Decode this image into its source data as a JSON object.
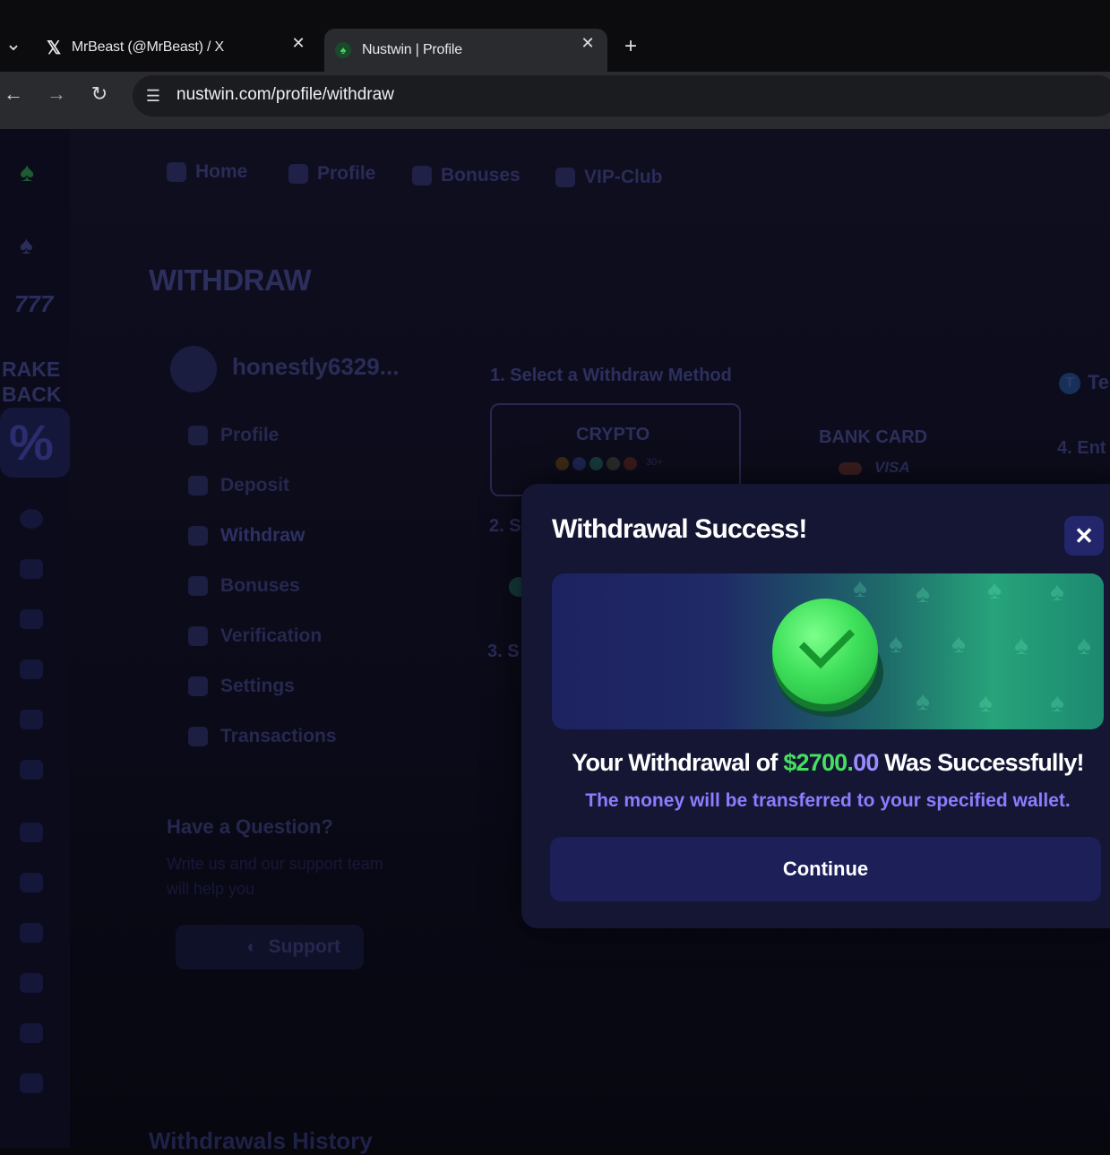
{
  "browser": {
    "tabs": [
      {
        "title": "MrBeast (@MrBeast) / X",
        "icon": "x-logo-icon"
      },
      {
        "title": "Nustwin | Profile",
        "icon": "nustwin-logo-icon"
      }
    ],
    "new_tab": "+",
    "url": "nustwin.com/profile/withdraw"
  },
  "nav": {
    "items": [
      {
        "label": "Home",
        "icon": "home-icon"
      },
      {
        "label": "Profile",
        "icon": "user-icon"
      },
      {
        "label": "Bonuses",
        "icon": "gift-icon"
      },
      {
        "label": "VIP-Club",
        "icon": "star-icon"
      }
    ]
  },
  "sidebar": {
    "rakeback_line1": "RAKE",
    "rakeback_line2": "BACK",
    "sevens": "777"
  },
  "page": {
    "title": "WITHDRAW",
    "username": "honestly6329...",
    "menu": [
      {
        "label": "Profile",
        "icon": "user-icon"
      },
      {
        "label": "Deposit",
        "icon": "wallet-icon"
      },
      {
        "label": "Withdraw",
        "icon": "bag-icon"
      },
      {
        "label": "Bonuses",
        "icon": "gift-icon"
      },
      {
        "label": "Verification",
        "icon": "shield-icon"
      },
      {
        "label": "Settings",
        "icon": "gear-icon"
      },
      {
        "label": "Transactions",
        "icon": "list-icon"
      }
    ],
    "method_label": "1. Select a Withdraw Method",
    "crypto_label": "CRYPTO",
    "crypto_more": "30+",
    "bank_label": "BANK CARD",
    "visa_label": "VISA",
    "step2": "2. S",
    "step3": "3. S",
    "right_te": "Te",
    "right_t": "T",
    "right_ent": "4. Ent",
    "question_title": "Have a Question?",
    "question_text": "Write us and our support team will help you",
    "support_label": "Support",
    "history_title": "Withdrawals History"
  },
  "modal": {
    "title": "Withdrawal Success!",
    "close": "✕",
    "message_prefix": "Your Withdrawal of ",
    "amount_main": "$2700.",
    "amount_cents": "00",
    "message_suffix": " Was Successfully!",
    "subtext": "The money will be transferred to your specified wallet.",
    "continue_label": "Continue"
  },
  "colors": {
    "accent_green": "#45e060",
    "accent_purple": "#8b7dff",
    "modal_bg": "#141634",
    "button_bg": "#1c1f58"
  }
}
